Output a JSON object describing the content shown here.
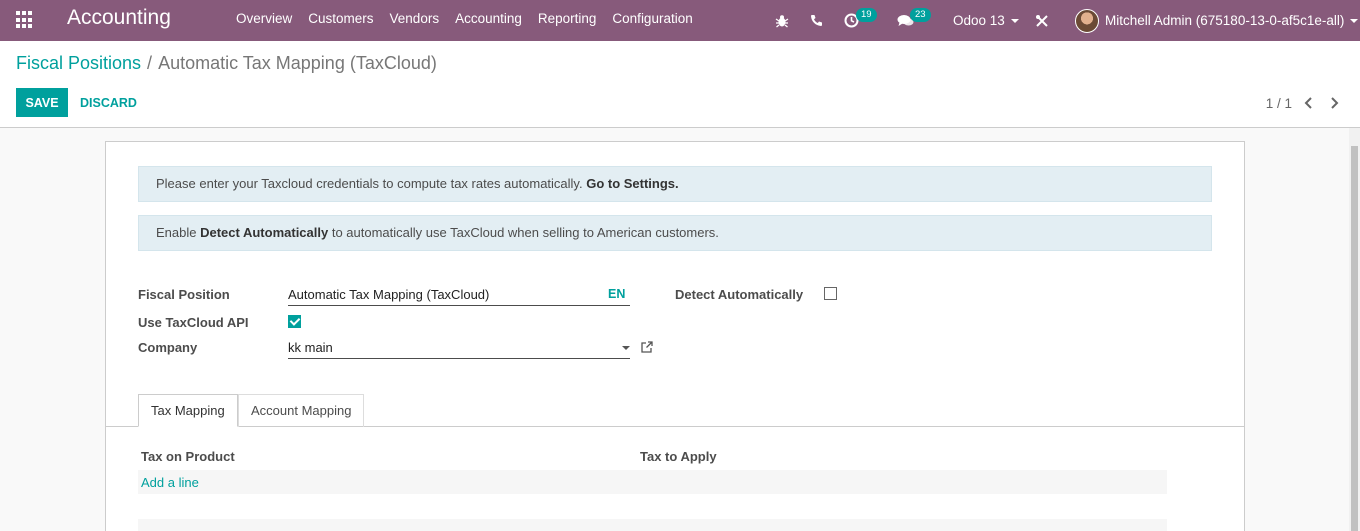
{
  "navbar": {
    "brand": "Accounting",
    "menu": [
      "Overview",
      "Customers",
      "Vendors",
      "Accounting",
      "Reporting",
      "Configuration"
    ],
    "activity_count": "19",
    "messages_count": "23",
    "db_name": "Odoo 13",
    "user_name": "Mitchell Admin (675180-13-0-af5c1e-all)"
  },
  "breadcrumb": {
    "parent": "Fiscal Positions",
    "separator": "/",
    "current": "Automatic Tax Mapping (TaxCloud)"
  },
  "buttons": {
    "save": "SAVE",
    "discard": "DISCARD"
  },
  "pager": {
    "value": "1 / 1"
  },
  "alerts": {
    "credentials_text": "Please enter your Taxcloud credentials to compute tax rates automatically.",
    "credentials_link": "Go to Settings.",
    "enable_prefix": "Enable",
    "enable_bold": "Detect Automatically",
    "enable_suffix": "to automatically use TaxCloud when selling to American customers."
  },
  "form": {
    "fiscal_position_label": "Fiscal Position",
    "fiscal_position_value": "Automatic Tax Mapping (TaxCloud)",
    "lang": "EN",
    "use_taxcloud_label": "Use TaxCloud API",
    "use_taxcloud_checked": true,
    "company_label": "Company",
    "company_value": "kk main",
    "detect_auto_label": "Detect Automatically",
    "detect_auto_checked": false
  },
  "tabs": [
    "Tax Mapping",
    "Account Mapping"
  ],
  "table": {
    "col_tax_on_product": "Tax on Product",
    "col_tax_to_apply": "Tax to Apply",
    "add_line": "Add a line"
  },
  "colors": {
    "brand": "#875a7b",
    "accent": "#00a09d",
    "alert_bg": "#e3eef3"
  }
}
